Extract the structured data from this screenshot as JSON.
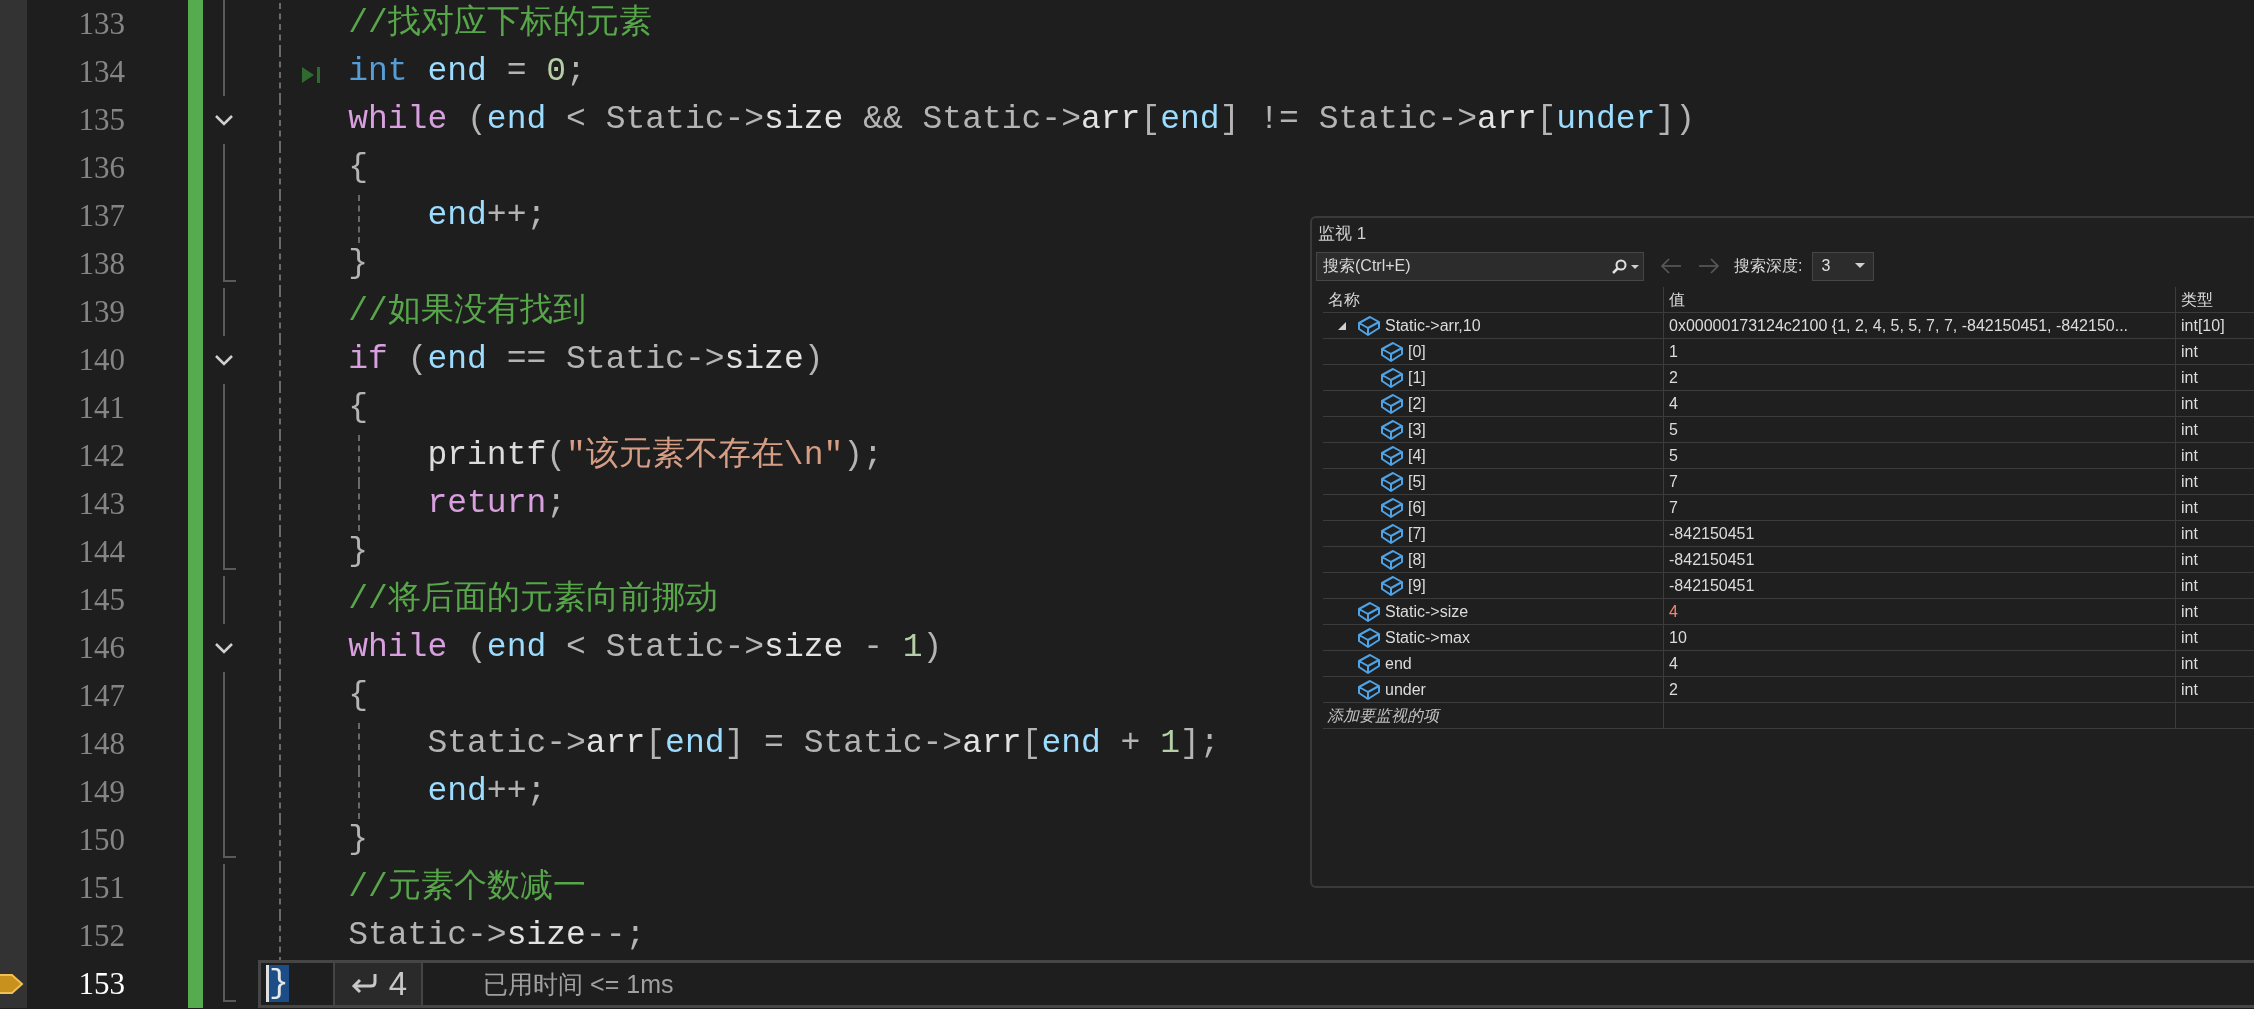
{
  "editor": {
    "lines": [
      {
        "number": "133",
        "kind": "block_line",
        "current": false,
        "run_to_click": false,
        "tokens": [
          {
            "kind": "comment",
            "text": "//找对应下标的元素"
          }
        ]
      },
      {
        "number": "134",
        "kind": "block_line",
        "current": false,
        "run_to_click": true,
        "tokens": [
          {
            "kind": "keyword",
            "text": "int"
          },
          {
            "kind": "var",
            "text": " end"
          },
          {
            "kind": "plain",
            "text": " = "
          },
          {
            "kind": "number",
            "text": "0"
          },
          {
            "kind": "plain",
            "text": ";"
          }
        ]
      },
      {
        "number": "135",
        "kind": "block_start",
        "current": false,
        "run_to_click": false,
        "tokens": [
          {
            "kind": "control",
            "text": "while"
          },
          {
            "kind": "plain",
            "text": " ("
          },
          {
            "kind": "var",
            "text": "end"
          },
          {
            "kind": "plain",
            "text": " < Static->"
          },
          {
            "kind": "member",
            "text": "size"
          },
          {
            "kind": "plain",
            "text": " && Static->"
          },
          {
            "kind": "member",
            "text": "arr"
          },
          {
            "kind": "plain",
            "text": "["
          },
          {
            "kind": "var",
            "text": "end"
          },
          {
            "kind": "plain",
            "text": "] != Static->"
          },
          {
            "kind": "member",
            "text": "arr"
          },
          {
            "kind": "plain",
            "text": "["
          },
          {
            "kind": "var",
            "text": "under"
          },
          {
            "kind": "plain",
            "text": "])"
          }
        ]
      },
      {
        "number": "136",
        "kind": "block_line",
        "current": false,
        "run_to_click": false,
        "tokens": [
          {
            "kind": "plain",
            "text": "{"
          }
        ]
      },
      {
        "number": "137",
        "kind": "block_line",
        "current": false,
        "run_to_click": false,
        "tokens": [
          {
            "kind": "var",
            "text": "end"
          },
          {
            "kind": "plain",
            "text": "++;"
          }
        ]
      },
      {
        "number": "138",
        "kind": "block_end",
        "current": false,
        "run_to_click": false,
        "tokens": [
          {
            "kind": "plain",
            "text": "}"
          }
        ]
      },
      {
        "number": "139",
        "kind": "block_line",
        "current": false,
        "run_to_click": false,
        "tokens": [
          {
            "kind": "comment",
            "text": "//如果没有找到"
          }
        ]
      },
      {
        "number": "140",
        "kind": "block_start",
        "current": false,
        "run_to_click": false,
        "tokens": [
          {
            "kind": "control",
            "text": "if"
          },
          {
            "kind": "plain",
            "text": " ("
          },
          {
            "kind": "var",
            "text": "end"
          },
          {
            "kind": "plain",
            "text": " == Static->"
          },
          {
            "kind": "member",
            "text": "size"
          },
          {
            "kind": "plain",
            "text": ")"
          }
        ]
      },
      {
        "number": "141",
        "kind": "block_line",
        "current": false,
        "run_to_click": false,
        "tokens": [
          {
            "kind": "plain",
            "text": "{"
          }
        ]
      },
      {
        "number": "142",
        "kind": "block_line",
        "current": false,
        "run_to_click": false,
        "tokens": [
          {
            "kind": "function",
            "text": "printf"
          },
          {
            "kind": "plain",
            "text": "("
          },
          {
            "kind": "string",
            "text": "\"该元素不存在\\n\""
          },
          {
            "kind": "plain",
            "text": ");"
          }
        ]
      },
      {
        "number": "143",
        "kind": "block_line",
        "current": false,
        "run_to_click": false,
        "tokens": [
          {
            "kind": "control",
            "text": "return"
          },
          {
            "kind": "plain",
            "text": ";"
          }
        ]
      },
      {
        "number": "144",
        "kind": "block_end",
        "current": false,
        "run_to_click": false,
        "tokens": [
          {
            "kind": "plain",
            "text": "}"
          }
        ]
      },
      {
        "number": "145",
        "kind": "block_line",
        "current": false,
        "run_to_click": false,
        "tokens": [
          {
            "kind": "comment",
            "text": "//将后面的元素向前挪动"
          }
        ]
      },
      {
        "number": "146",
        "kind": "block_start",
        "current": false,
        "run_to_click": false,
        "tokens": [
          {
            "kind": "control",
            "text": "while"
          },
          {
            "kind": "plain",
            "text": " ("
          },
          {
            "kind": "var",
            "text": "end"
          },
          {
            "kind": "plain",
            "text": " < Static->"
          },
          {
            "kind": "member",
            "text": "size"
          },
          {
            "kind": "plain",
            "text": " - "
          },
          {
            "kind": "number",
            "text": "1"
          },
          {
            "kind": "plain",
            "text": ")"
          }
        ]
      },
      {
        "number": "147",
        "kind": "block_line",
        "current": false,
        "run_to_click": false,
        "tokens": [
          {
            "kind": "plain",
            "text": "{"
          }
        ]
      },
      {
        "number": "148",
        "kind": "block_line",
        "current": false,
        "run_to_click": false,
        "tokens": [
          {
            "kind": "plain",
            "text": "Static->"
          },
          {
            "kind": "member",
            "text": "arr"
          },
          {
            "kind": "plain",
            "text": "["
          },
          {
            "kind": "var",
            "text": "end"
          },
          {
            "kind": "plain",
            "text": "] = Static->"
          },
          {
            "kind": "member",
            "text": "arr"
          },
          {
            "kind": "plain",
            "text": "["
          },
          {
            "kind": "var",
            "text": "end"
          },
          {
            "kind": "plain",
            "text": " + "
          },
          {
            "kind": "number",
            "text": "1"
          },
          {
            "kind": "plain",
            "text": "];"
          }
        ]
      },
      {
        "number": "149",
        "kind": "block_line",
        "current": false,
        "run_to_click": false,
        "tokens": [
          {
            "kind": "var",
            "text": "end"
          },
          {
            "kind": "plain",
            "text": "++;"
          }
        ]
      },
      {
        "number": "150",
        "kind": "block_end",
        "current": false,
        "run_to_click": false,
        "tokens": [
          {
            "kind": "plain",
            "text": "}"
          }
        ]
      },
      {
        "number": "151",
        "kind": "block_line",
        "current": false,
        "run_to_click": false,
        "tokens": [
          {
            "kind": "comment",
            "text": "//元素个数减一"
          }
        ]
      },
      {
        "number": "152",
        "kind": "block_line",
        "current": false,
        "run_to_click": false,
        "tokens": [
          {
            "kind": "plain",
            "text": "Static->"
          },
          {
            "kind": "member",
            "text": "size"
          },
          {
            "kind": "plain",
            "text": "--;"
          }
        ]
      },
      {
        "number": "153",
        "kind": "block_end",
        "current": true,
        "run_to_click": false,
        "tokens": [
          {
            "kind": "cursor",
            "text": "}"
          }
        ]
      }
    ],
    "return_hint": {
      "value": "4"
    },
    "elapsed": "已用时间 <= 1ms"
  },
  "watch": {
    "title": "监视 1",
    "search": {
      "placeholder": "搜索(Ctrl+E)"
    },
    "depth_label": "搜索深度:",
    "depth": "3",
    "columns": [
      "名称",
      "值",
      "类型"
    ],
    "rows": [
      {
        "name": "Static->arr,10",
        "value": "0x00000173124c2100 {1, 2, 4, 5, 5, 7, 7, -842150451, -842150...",
        "type": "int[10]",
        "changed": false,
        "expanded": true,
        "children": [
          {
            "name": "[0]",
            "value": "1",
            "type": "int",
            "changed": false
          },
          {
            "name": "[1]",
            "value": "2",
            "type": "int",
            "changed": false
          },
          {
            "name": "[2]",
            "value": "4",
            "type": "int",
            "changed": false
          },
          {
            "name": "[3]",
            "value": "5",
            "type": "int",
            "changed": false
          },
          {
            "name": "[4]",
            "value": "5",
            "type": "int",
            "changed": false
          },
          {
            "name": "[5]",
            "value": "7",
            "type": "int",
            "changed": false
          },
          {
            "name": "[6]",
            "value": "7",
            "type": "int",
            "changed": false
          },
          {
            "name": "[7]",
            "value": "-842150451",
            "type": "int",
            "changed": false
          },
          {
            "name": "[8]",
            "value": "-842150451",
            "type": "int",
            "changed": false
          },
          {
            "name": "[9]",
            "value": "-842150451",
            "type": "int",
            "changed": false
          }
        ]
      },
      {
        "name": "Static->size",
        "value": "4",
        "type": "int",
        "changed": true
      },
      {
        "name": "Static->max",
        "value": "10",
        "type": "int",
        "changed": false
      },
      {
        "name": "end",
        "value": "4",
        "type": "int",
        "changed": false
      },
      {
        "name": "under",
        "value": "2",
        "type": "int",
        "changed": false
      }
    ],
    "add_row": {
      "placeholder": "添加要监视的项"
    }
  }
}
